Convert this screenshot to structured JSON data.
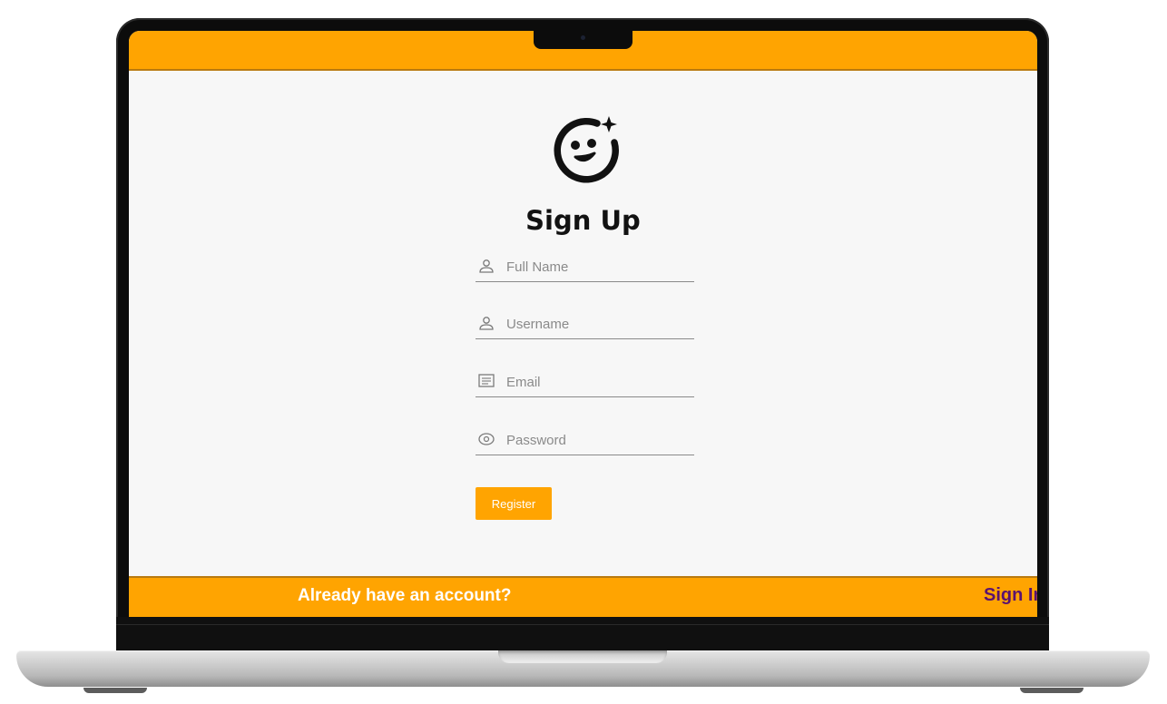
{
  "form": {
    "title": "Sign Up",
    "fields": [
      {
        "name": "full_name",
        "placeholder": "Full Name",
        "value": "",
        "icon": "user-icon"
      },
      {
        "name": "username",
        "placeholder": "Username",
        "value": "",
        "icon": "user-icon"
      },
      {
        "name": "email",
        "placeholder": "Email",
        "value": "",
        "icon": "email-icon"
      },
      {
        "name": "password",
        "placeholder": "Password",
        "value": "",
        "icon": "lock-icon"
      }
    ],
    "register_label": "Register"
  },
  "footer": {
    "prompt": "Already have an account?",
    "signin_label": "Sign In"
  },
  "colors": {
    "accent": "#ffa401",
    "link": "#5a1270",
    "title": "#121212"
  },
  "logo_icon": "smiley-sparkle-icon"
}
